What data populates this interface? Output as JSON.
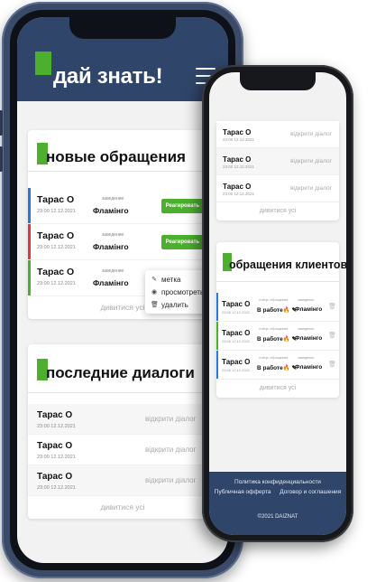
{
  "brand": {
    "logo_text": "дай знать!"
  },
  "colors": {
    "header_blue": "#2f4569",
    "accent_green": "#4caf2e",
    "stripe_blue": "#2b78d6",
    "stripe_red": "#e0373a",
    "stripe_green": "#4caf2e"
  },
  "new_requests": {
    "title": "новые обращения",
    "rows": [
      {
        "name": "Тарас О",
        "date": "23:00 12.12.2021",
        "org_label": "заведение",
        "org": "Фламінго",
        "button": "Реагировать 🔥"
      },
      {
        "name": "Тарас О",
        "date": "23:00 12.12.2021",
        "org_label": "заведение",
        "org": "Фламінго",
        "button": "Реагировать 🔥"
      },
      {
        "name": "Тарас О",
        "date": "23:00 12.12.2021",
        "org_label": "заведение",
        "org": "Фламінго"
      }
    ],
    "see_all": "дивитися усі",
    "context_menu": [
      {
        "icon": "pencil-icon",
        "label": "метка"
      },
      {
        "icon": "eye-icon",
        "label": "просмотреть"
      },
      {
        "icon": "trash-icon",
        "label": "удалить"
      }
    ]
  },
  "last_dialogs": {
    "title": "последние диалоги",
    "rows": [
      {
        "name": "Тарас О",
        "date": "23:00 12.12.2021",
        "action": "відкрити діалог"
      },
      {
        "name": "Тарас О",
        "date": "23:00 12.12.2021",
        "action": "відкрити діалог"
      },
      {
        "name": "Тарас О",
        "date": "23:00 12.12.2021",
        "action": "відкрити діалог"
      }
    ],
    "see_all": "дивитися усі"
  },
  "phone2_dialogs": {
    "rows": [
      {
        "name": "Тарас О",
        "date": "23:00 12.12.2021",
        "action": "відкрити діалог"
      },
      {
        "name": "Тарас О",
        "date": "23:00 12.12.2021",
        "action": "відкрити діалог"
      },
      {
        "name": "Тарас О",
        "date": "23:00 12.12.2021",
        "action": "відкрити діалог"
      }
    ],
    "see_all": "дивитися усі"
  },
  "client_requests": {
    "title": "обращения клиентов",
    "rows": [
      {
        "name": "Тарас О",
        "date": "23:00 12.12.2021",
        "status_label": "статус обращения",
        "status": "В работе🔥 ✎",
        "org_label": "заведение",
        "org": "Фламінго"
      },
      {
        "name": "Тарас О",
        "date": "23:00 12.12.2021",
        "status_label": "статус обращения",
        "status": "В работе🔥 ✎",
        "org_label": "заведение",
        "org": "Фламінго"
      },
      {
        "name": "Тарас О",
        "date": "23:00 12.12.2021",
        "status_label": "статус обращения",
        "status": "В работе🔥 ✎",
        "org_label": "заведение",
        "org": "Фламінго"
      }
    ],
    "see_all": "дивитися усі"
  },
  "footer": {
    "privacy": "Политика конфиденциальности",
    "offer": "Публичная офферта",
    "agreement": "Договор и соглашения",
    "copyright": "©2021 DAIZNAT"
  }
}
